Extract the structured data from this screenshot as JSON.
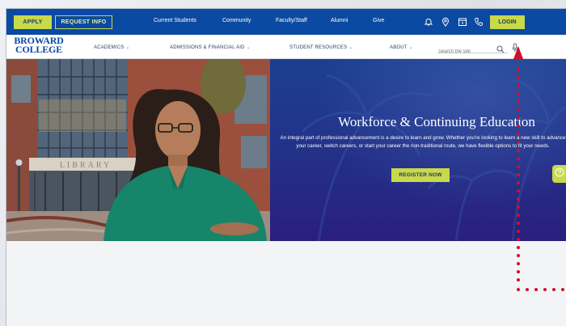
{
  "utility_bar": {
    "apply_label": "APPLY",
    "request_info_label": "REQUEST INFO",
    "links": [
      "Current Students",
      "Community",
      "Faculty/Staff",
      "Alumni",
      "Give"
    ],
    "login_label": "LOGIN",
    "icons": [
      "bell-icon",
      "location-pin-icon",
      "calendar-icon",
      "phone-icon"
    ]
  },
  "main_nav": {
    "logo_line1": "BROWARD",
    "logo_line2": "COLLEGE",
    "items": [
      "ACADEMICS",
      "ADMISSIONS & FINANCIAL AID",
      "STUDENT RESOURCES",
      "ABOUT"
    ],
    "search_placeholder": "Search the site"
  },
  "hero": {
    "building_sign": "LIBRARY",
    "title": "Workforce & Continuing Education",
    "description": "An integral part of professional advancement is a desire to learn and grow. Whether you're looking to learn a new skill to advance your career, switch careers, or start your career the non-traditional route, we have flexible options to fit your needs.",
    "register_label": "REGISTER NOW",
    "help_icon": "help-circle-icon"
  },
  "colors": {
    "brand_blue": "#0b4aa2",
    "accent_green": "#c8d94a",
    "annotation_red": "#d1102a"
  }
}
